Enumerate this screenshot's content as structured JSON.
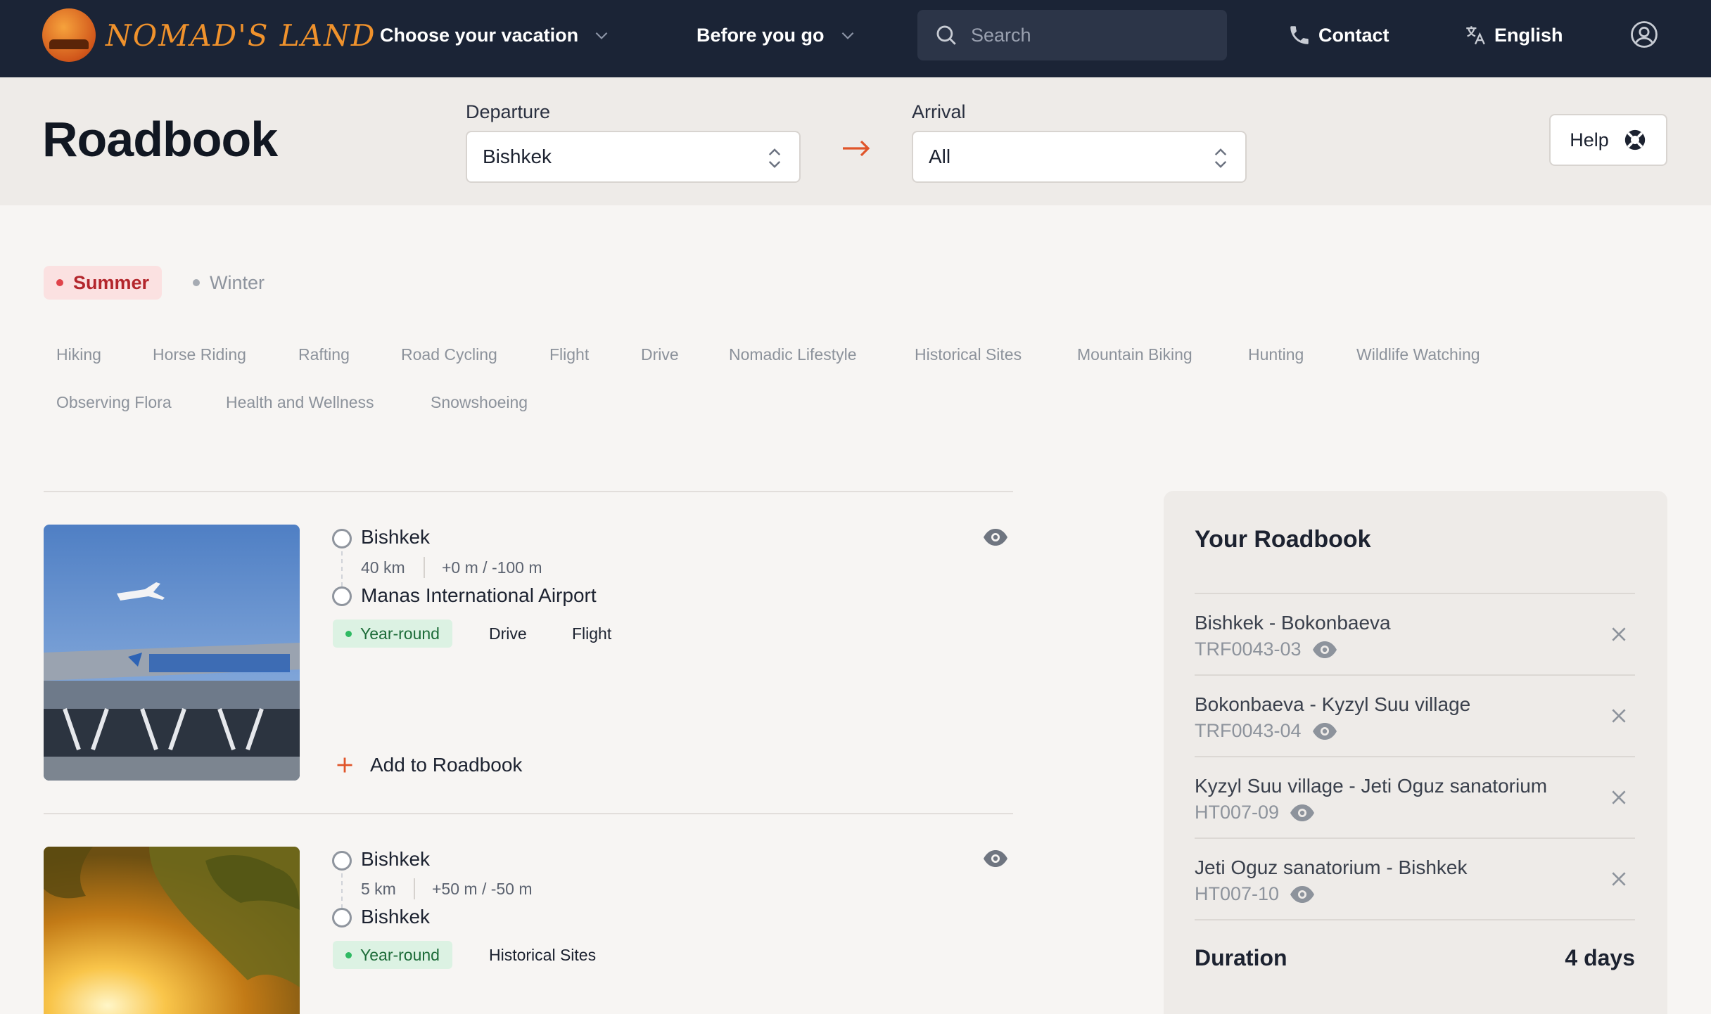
{
  "nav": {
    "logo_text": "NOMAD'S LAND",
    "choose_vacation": "Choose your vacation",
    "before_you_go": "Before you go",
    "search_placeholder": "Search",
    "contact": "Contact",
    "language": "English"
  },
  "header": {
    "title": "Roadbook",
    "departure_label": "Departure",
    "departure_value": "Bishkek",
    "arrival_label": "Arrival",
    "arrival_value": "All",
    "help_label": "Help"
  },
  "seasons": [
    "Summer",
    "Winter"
  ],
  "activities": [
    "Hiking",
    "Horse Riding",
    "Rafting",
    "Road Cycling",
    "Flight",
    "Drive",
    "Nomadic Lifestyle",
    "Historical Sites",
    "Mountain Biking",
    "Hunting",
    "Wildlife Watching",
    "Observing Flora",
    "Health and Wellness",
    "Snowshoeing"
  ],
  "routes": [
    {
      "from": "Bishkek",
      "to": "Manas International Airport",
      "distance": "40 km",
      "elevation": "+0 m / -100 m",
      "season": "Year-round",
      "tags": [
        "Drive",
        "Flight"
      ],
      "add_label": "Add to Roadbook"
    },
    {
      "from": "Bishkek",
      "to": "Bishkek",
      "distance": "5 km",
      "elevation": "+50 m / -50 m",
      "season": "Year-round",
      "tags": [
        "Historical Sites"
      ]
    }
  ],
  "roadbook": {
    "title": "Your Roadbook",
    "items": [
      {
        "name": "Bishkek - Bokonbaeva",
        "code": "TRF0043-03"
      },
      {
        "name": "Bokonbaeva - Kyzyl Suu village",
        "code": "TRF0043-04"
      },
      {
        "name": "Kyzyl Suu village - Jeti Oguz sanatorium",
        "code": "HT007-09"
      },
      {
        "name": "Jeti Oguz sanatorium - Bishkek",
        "code": "HT007-10"
      }
    ],
    "duration_label": "Duration",
    "duration_value": "4 days"
  },
  "colors": {
    "nav_bg": "#1b2436",
    "accent_orange": "#e0552a",
    "season_active": "#b3262c",
    "year_round": "#1c6b38"
  }
}
